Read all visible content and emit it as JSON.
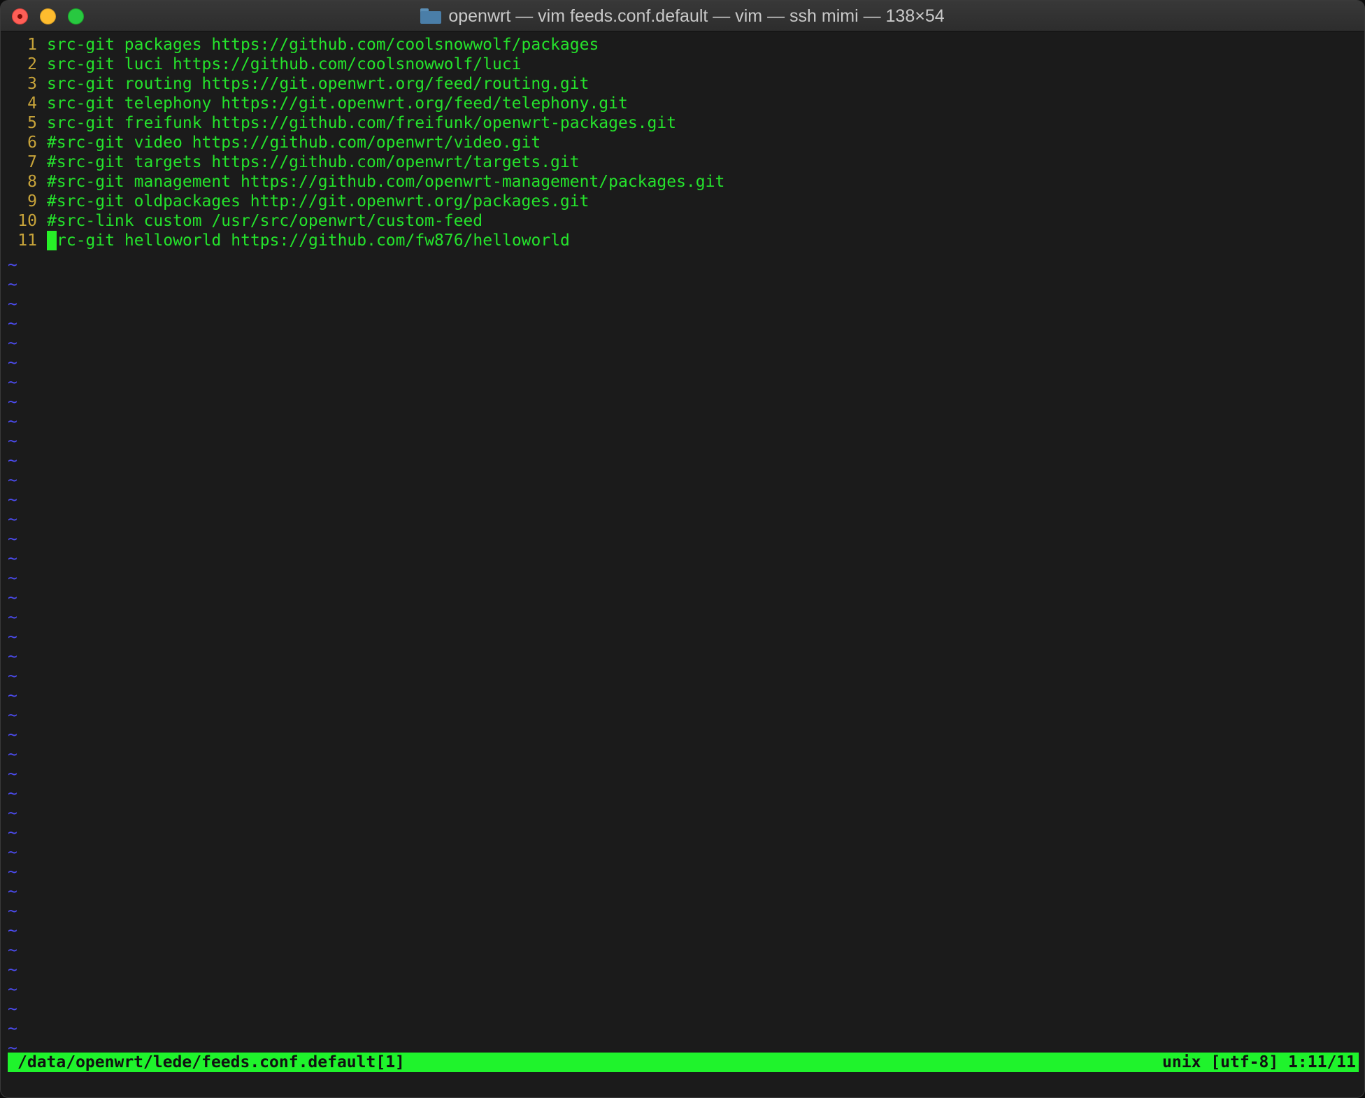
{
  "window": {
    "title": "openwrt — vim feeds.conf.default — vim — ssh mimi — 138×54",
    "icon": "folder-icon"
  },
  "editor": {
    "lines": [
      {
        "num": "1",
        "text": "src-git packages https://github.com/coolsnowwolf/packages"
      },
      {
        "num": "2",
        "text": "src-git luci https://github.com/coolsnowwolf/luci"
      },
      {
        "num": "3",
        "text": "src-git routing https://git.openwrt.org/feed/routing.git"
      },
      {
        "num": "4",
        "text": "src-git telephony https://git.openwrt.org/feed/telephony.git"
      },
      {
        "num": "5",
        "text": "src-git freifunk https://github.com/freifunk/openwrt-packages.git"
      },
      {
        "num": "6",
        "text": "#src-git video https://github.com/openwrt/video.git"
      },
      {
        "num": "7",
        "text": "#src-git targets https://github.com/openwrt/targets.git"
      },
      {
        "num": "8",
        "text": "#src-git management https://github.com/openwrt-management/packages.git"
      },
      {
        "num": "9",
        "text": "#src-git oldpackages http://git.openwrt.org/packages.git"
      },
      {
        "num": "10",
        "text": "#src-link custom /usr/src/openwrt/custom-feed"
      },
      {
        "num": "11",
        "cursor_char": "s",
        "text": "rc-git helloworld https://github.com/fw876/helloworld"
      }
    ],
    "empty_line_marker": "~"
  },
  "statusline": {
    "path": "/data/openwrt/lede/feeds.conf.default[1]",
    "info": "unix [utf-8] 1:11/11"
  },
  "colors": {
    "background": "#1b1b1b",
    "text": "#25e32c",
    "line_number": "#c8a43a",
    "tilde": "#4c4cf0",
    "statusbar": "#1ff32c"
  }
}
